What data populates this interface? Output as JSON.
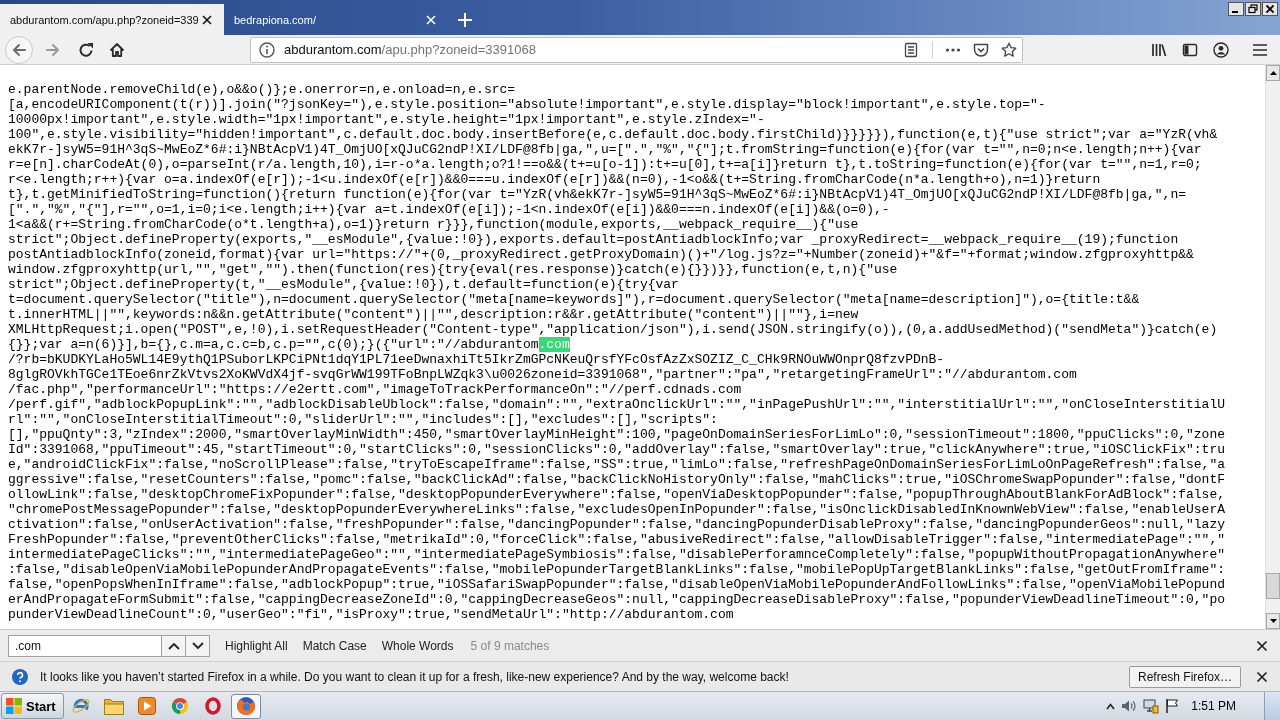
{
  "tabs": [
    {
      "title": "abdurantom.com/apu.php?zoneid=339",
      "selected": true
    },
    {
      "title": "bedrapiona.com/",
      "selected": false
    }
  ],
  "address_bar": {
    "domain": "abdurantom.com",
    "path": "/apu.php?zoneid=3391068"
  },
  "page": {
    "lines": [
      {
        "parts": [
          {
            "text": "e.parentNode.removeChild(e),o&&o()};e.onerror=n,e.onload=n,e.src=",
            "highlighted": false
          }
        ]
      },
      {
        "parts": [
          {
            "text": "[a,encodeURIComponent(t(r))].join(\"?jsonKey=\"),e.style.position=\"absolute!important\",e.style.display=\"block!important\",e.style.top=\"-",
            "highlighted": false
          }
        ]
      },
      {
        "parts": [
          {
            "text": "10000px!important\",e.style.width=\"1px!important\",e.style.height=\"1px!important\",e.style.zIndex=\"-",
            "highlighted": false
          }
        ]
      },
      {
        "parts": [
          {
            "text": "100\",e.style.visibility=\"hidden!important\",c.default.doc.body.insertBefore(e,c.default.doc.body.firstChild)}}}}}),function(e,t){\"use strict\";var a=\"YzR(vh&",
            "highlighted": false
          }
        ]
      },
      {
        "parts": [
          {
            "text": "ekK7r-]syW5=91H^3qS~MwEoZ*6#:i}NBtAcpV1)4T_OmjUO[xQJuCG2ndP!XI/LDF@8fb|ga,\",u=[\".\",\"%\",\"{\"];t.fromString=function(e){for(var t=\"\",n=0;n<e.length;n++){var",
            "highlighted": false
          }
        ]
      },
      {
        "parts": [
          {
            "text": "r=e[n].charCodeAt(0),o=parseInt(r/a.length,10),i=r-o*a.length;o?1!==o&&(t+=u[o-1]):t+=u[0],t+=a[i]}return t},t.toString=function(e){for(var t=\"\",n=1,r=0;",
            "highlighted": false
          }
        ]
      },
      {
        "parts": [
          {
            "text": "r<e.length;r++){var o=a.indexOf(e[r]);-1<u.indexOf(e[r])&&0===u.indexOf(e[r])&&(n=0),-1<o&&(t+=String.fromCharCode(n*a.length+o),n=1)}return",
            "highlighted": false
          }
        ]
      },
      {
        "parts": [
          {
            "text": "t},t.getMinifiedToString=function(){return function(e){for(var t=\"YzR(vh&ekK7r-]syW5=91H^3qS~MwEoZ*6#:i}NBtAcpV1)4T_OmjUO[xQJuCG2ndP!XI/LDF@8fb|ga,\",n=",
            "highlighted": false
          }
        ]
      },
      {
        "parts": [
          {
            "text": "[\".\",\"%\",\"{\"],r=\"\",o=1,i=0;i<e.length;i++){var a=t.indexOf(e[i]);-1<n.indexOf(e[i])&&0===n.indexOf(e[i])&&(o=0),-",
            "highlighted": false
          }
        ]
      },
      {
        "parts": [
          {
            "text": "1<a&&(r+=String.fromCharCode(o*t.length+a),o=1)}return r}}},function(module,exports,__webpack_require__){\"use",
            "highlighted": false
          }
        ]
      },
      {
        "parts": [
          {
            "text": "strict\";Object.defineProperty(exports,\"__esModule\",{value:!0}),exports.default=postAntiadblockInfo;var _proxyRedirect=__webpack_require__(19);function",
            "highlighted": false
          }
        ]
      },
      {
        "parts": [
          {
            "text": "postAntiadblockInfo(zoneid,format){var url=\"https://\"+(0,_proxyRedirect.getProxyDomain)()+\"/log.js?z=\"+Number(zoneid)+\"&f=\"+format;window.zfgproxyhttp&&",
            "highlighted": false
          }
        ]
      },
      {
        "parts": [
          {
            "text": "window.zfgproxyhttp(url,\"\",\"get\",\"\").then(function(res){try{eval(res.response)}catch(e){}})}},function(e,t,n){\"use",
            "highlighted": false
          }
        ]
      },
      {
        "parts": [
          {
            "text": "strict\";Object.defineProperty(t,\"__esModule\",{value:!0}),t.default=function(e){try{var",
            "highlighted": false
          }
        ]
      },
      {
        "parts": [
          {
            "text": "t=document.querySelector(\"title\"),n=document.querySelector(\"meta[name=keywords]\"),r=document.querySelector(\"meta[name=description]\"),o={title:t&&",
            "highlighted": false
          }
        ]
      },
      {
        "parts": [
          {
            "text": "t.innerHTML||\"\",keywords:n&&n.getAttribute(\"content\")||\"\",description:r&&r.getAttribute(\"content\")||\"\"},i=new",
            "highlighted": false
          }
        ]
      },
      {
        "parts": [
          {
            "text": "XMLHttpRequest;i.open(\"POST\",e,!0),i.setRequestHeader(\"Content-type\",\"application/json\"),i.send(JSON.stringify(o)),(0,a.addUsedMethod)(\"sendMeta\")}catch(e)",
            "highlighted": false
          }
        ]
      },
      {
        "parts": [
          {
            "text": "{}};var a=n(6)}],b={},c.m=a,c.c=b,c.p=\"\",c(0);}({\"url\":\"//abdurantom",
            "highlighted": false
          },
          {
            "text": ".com",
            "highlighted": true
          }
        ]
      },
      {
        "parts": [
          {
            "text": "/?rb=bKUDKYLaHo5WL14E9ythQ1PSuborLKPCiPNt1dqY1PL71eeDwnaxhiTt5IkrZmGPcNKeuQrsfYFcOsfAzZxSOZIZ_C_CHk9RNOuWWOnprQ8fzvPDnB-",
            "highlighted": false
          }
        ]
      },
      {
        "parts": [
          {
            "text": "8glgROVkhTGCe1TEoe6nrZkVtvs2XoKWVdX4jf-svqGrWW199TFoBnpLWZqk3\\u0026zoneid=3391068\",\"partner\":\"pa\",\"retargetingFrameUrl\":\"//abdurantom.com",
            "highlighted": false
          }
        ]
      },
      {
        "parts": [
          {
            "text": "/fac.php\",\"performanceUrl\":\"https://e2ertt.com\",\"imageToTrackPerformanceOn\":\"//perf.cdnads.com",
            "highlighted": false
          }
        ]
      },
      {
        "parts": [
          {
            "text": "/perf.gif\",\"adblockPopupLink\":\"\",\"adblockDisableUblock\":false,\"domain\":\"\",\"extraOnclickUrl\":\"\",\"inPagePushUrl\":\"\",\"interstitialUrl\":\"\",\"onCloseInterstitialU",
            "highlighted": false
          }
        ]
      },
      {
        "parts": [
          {
            "text": "rl\":\"\",\"onCloseInterstitialTimeout\":0,\"sliderUrl\":\"\",\"includes\":[],\"excludes\":[],\"scripts\":",
            "highlighted": false
          }
        ]
      },
      {
        "parts": [
          {
            "text": "[],\"ppuQnty\":3,\"zIndex\":2000,\"smartOverlayMinWidth\":450,\"smartOverlayMinHeight\":100,\"pageOnDomainSeriesForLimLo\":0,\"sessionTimeout\":1800,\"ppuClicks\":0,\"zone",
            "highlighted": false
          }
        ]
      },
      {
        "parts": [
          {
            "text": "Id\":3391068,\"ppuTimeout\":45,\"startTimeout\":0,\"startClicks\":0,\"sessionClicks\":0,\"addOverlay\":false,\"smartOverlay\":true,\"clickAnywhere\":true,\"iOSClickFix\":tru",
            "highlighted": false
          }
        ]
      },
      {
        "parts": [
          {
            "text": "e,\"androidClickFix\":false,\"noScrollPlease\":false,\"tryToEscapeIframe\":false,\"SS\":true,\"limLo\":false,\"refreshPageOnDomainSeriesForLimLoOnPageRefresh\":false,\"a",
            "highlighted": false
          }
        ]
      },
      {
        "parts": [
          {
            "text": "ggressive\":false,\"resetCounters\":false,\"pomc\":false,\"backClickAd\":false,\"backClickNoHistoryOnly\":false,\"mahClicks\":true,\"iOSChromeSwapPopunder\":false,\"dontF",
            "highlighted": false
          }
        ]
      },
      {
        "parts": [
          {
            "text": "ollowLink\":false,\"desktopChromeFixPopunder\":false,\"desktopPopunderEverywhere\":false,\"openViaDesktopPopunder\":false,\"popupThroughAboutBlankForAdBlock\":false,",
            "highlighted": false
          }
        ]
      },
      {
        "parts": [
          {
            "text": "\"chromePostMessagePopunder\":false,\"desktopPopunderEverywhereLinks\":false,\"excludesOpenInPopunder\":false,\"isOnclickDisabledInKnownWebView\":false,\"enableUserA",
            "highlighted": false
          }
        ]
      },
      {
        "parts": [
          {
            "text": "ctivation\":false,\"onUserActivation\":false,\"freshPopunder\":false,\"dancingPopunder\":false,\"dancingPopunderDisableProxy\":false,\"dancingPopunderGeos\":null,\"lazy",
            "highlighted": false
          }
        ]
      },
      {
        "parts": [
          {
            "text": "FreshPopunder\":false,\"preventOtherClicks\":false,\"metrikaId\":0,\"forceClick\":false,\"abusiveRedirect\":false,\"allowDisableTrigger\":false,\"intermediatePage\":\"\",\"",
            "highlighted": false
          }
        ]
      },
      {
        "parts": [
          {
            "text": "intermediatePageClicks\":\"\",\"intermediatePageGeo\":\"\",\"intermediatePageSymbiosis\":false,\"disablePerforamnceCompletely\":false,\"popupWithoutPropagationAnywhere\"",
            "highlighted": false
          }
        ]
      },
      {
        "parts": [
          {
            "text": ":false,\"disableOpenViaMobilePopunderAndPropagateEvents\":false,\"mobilePopunderTargetBlankLinks\":false,\"mobilePopUpTargetBlankLinks\":false,\"getOutFromIframe\":",
            "highlighted": false
          }
        ]
      },
      {
        "parts": [
          {
            "text": "false,\"openPopsWhenInIframe\":false,\"adblockPopup\":true,\"iOSSafariSwapPopunder\":false,\"disableOpenViaMobilePopunderAndFollowLinks\":false,\"openViaMobilePopund",
            "highlighted": false
          }
        ]
      },
      {
        "parts": [
          {
            "text": "erAndPropagateFormSubmit\":false,\"cappingDecreaseZoneId\":0,\"cappingDecreaseGeos\":null,\"cappingDecreaseDisableProxy\":false,\"popunderViewDeadlineTimeout\":0,\"po",
            "highlighted": false
          }
        ]
      },
      {
        "parts": [
          {
            "text": "punderViewDeadlineCount\":0,\"userGeo\":\"fi\",\"isProxy\":true,\"sendMetaUrl\":\"http://abdurantom.com",
            "highlighted": false
          }
        ]
      }
    ]
  },
  "find_bar": {
    "value": ".com",
    "options": [
      "Highlight All",
      "Match Case",
      "Whole Words"
    ],
    "status": "5 of 9 matches"
  },
  "notification": {
    "message": "It looks like you haven’t started Firefox in a while. Do you want to clean it up for a fresh, like-new experience? And by the way, welcome back!",
    "button": "Refresh Firefox…"
  },
  "taskbar": {
    "start": "Start",
    "apps": [
      {
        "kind": "ie",
        "selected": false
      },
      {
        "kind": "folder",
        "selected": false
      },
      {
        "kind": "player",
        "selected": false
      },
      {
        "kind": "chrome",
        "selected": false
      },
      {
        "kind": "opera",
        "selected": false
      },
      {
        "kind": "firefox",
        "selected": true
      }
    ],
    "clock": "1:51 PM"
  }
}
